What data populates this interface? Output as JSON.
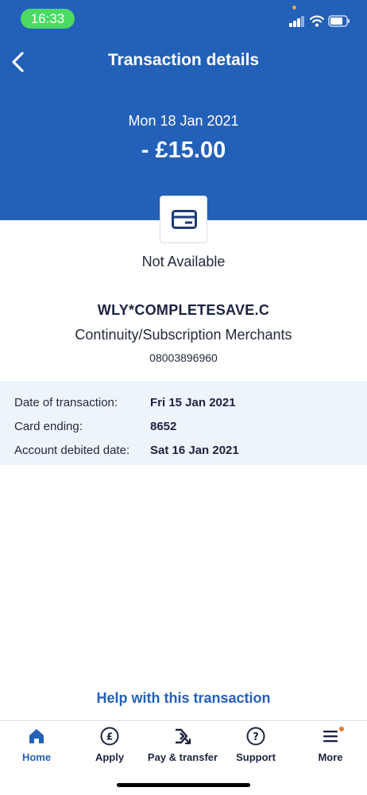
{
  "status_bar": {
    "time": "16:33"
  },
  "header": {
    "title": "Transaction details",
    "date": "Mon 18 Jan 2021",
    "amount": "- £15.00"
  },
  "card": {
    "status": "Not Available"
  },
  "merchant": {
    "name": "WLY*COMPLETESAVE.C",
    "category": "Continuity/Subscription Merchants",
    "phone": "08003896960"
  },
  "details": [
    {
      "label": "Date of transaction:",
      "value": "Fri 15 Jan 2021"
    },
    {
      "label": "Card ending:",
      "value": "8652"
    },
    {
      "label": "Account debited date:",
      "value": "Sat 16 Jan 2021"
    }
  ],
  "help_link": "Help with this transaction",
  "tabs": [
    {
      "label": "Home",
      "icon": "home-icon",
      "active": true
    },
    {
      "label": "Apply",
      "icon": "pound-circle-icon"
    },
    {
      "label": "Pay & transfer",
      "icon": "transfer-arrows-icon"
    },
    {
      "label": "Support",
      "icon": "question-circle-icon"
    },
    {
      "label": "More",
      "icon": "menu-icon"
    }
  ],
  "colors": {
    "brand_blue": "#2360b8",
    "panel_bg": "#eef4fc",
    "notification_dot": "#e07b2e"
  }
}
